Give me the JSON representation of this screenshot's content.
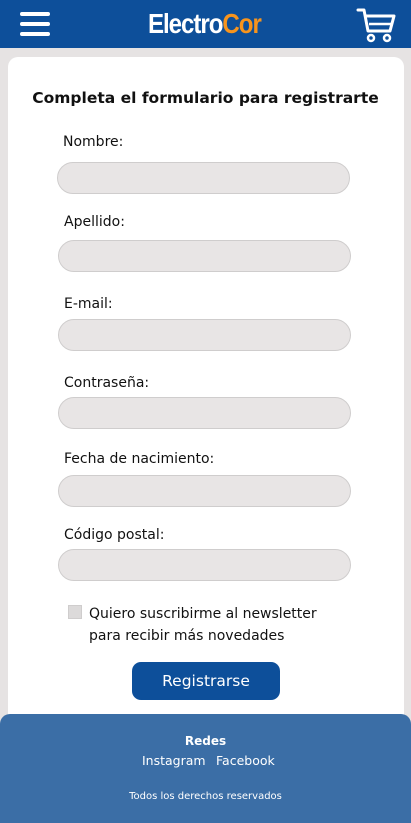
{
  "header": {
    "logo_part1": "Electro",
    "logo_part2": "Cor",
    "menu_icon": "hamburger-menu-icon",
    "cart_icon": "shopping-cart-icon",
    "brand_color": "#0d4f9a",
    "accent_color": "#f7941d"
  },
  "form": {
    "title": "Completa el formulario para registrarte",
    "fields": [
      {
        "label": "Nombre:",
        "value": ""
      },
      {
        "label": "Apellido:",
        "value": ""
      },
      {
        "label": "E-mail:",
        "value": ""
      },
      {
        "label": "Contraseña:",
        "value": ""
      },
      {
        "label": "Fecha de nacimiento:",
        "value": ""
      },
      {
        "label": "Código postal:",
        "value": ""
      }
    ],
    "newsletter_label": "Quiero suscribirme al newsletter para recibir más novedades",
    "newsletter_checked": false,
    "submit_label": "Registrarse"
  },
  "footer": {
    "title": "Redes",
    "links": [
      "Instagram",
      "Facebook"
    ],
    "rights": "Todos los derechos reservados",
    "color": "#3b6ea6"
  }
}
